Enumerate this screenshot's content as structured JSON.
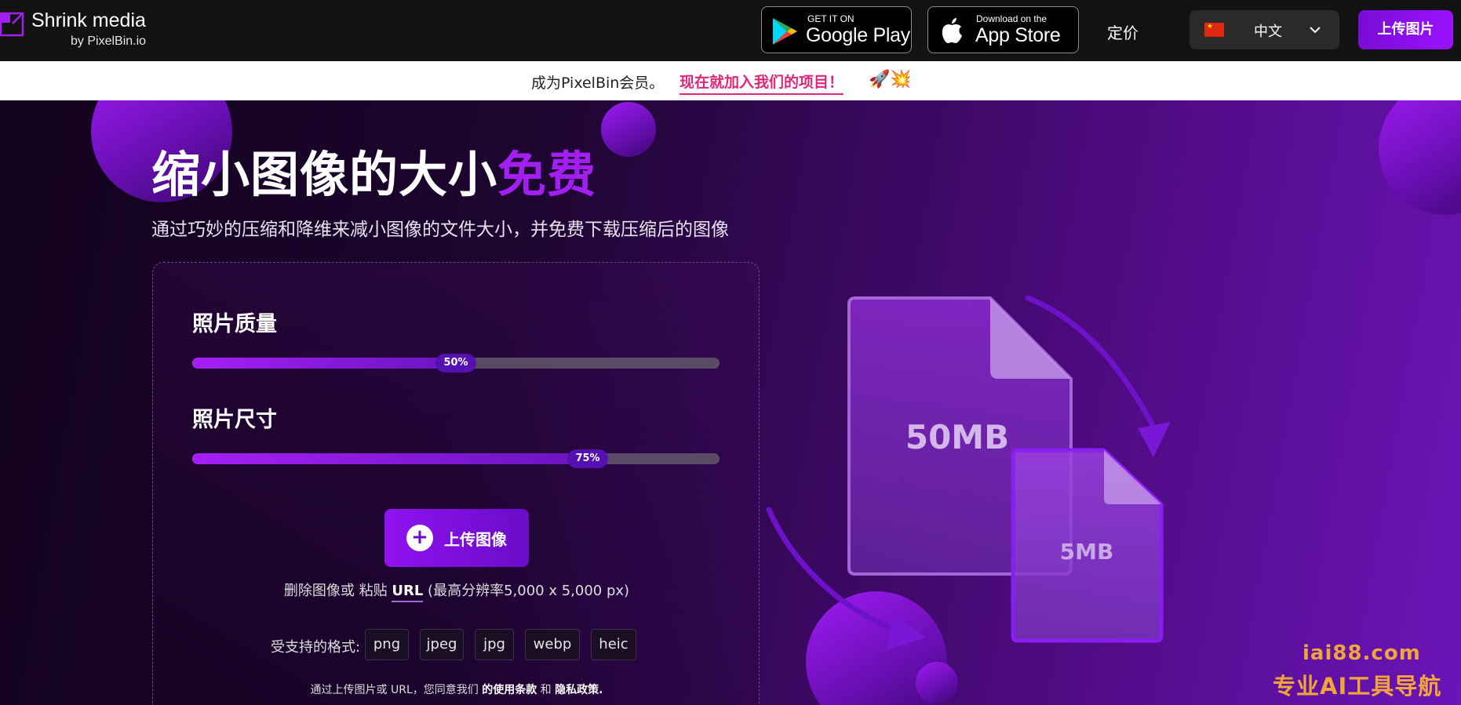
{
  "nav": {
    "logo_title": "Shrink media",
    "logo_sub": "by PixelBin.io",
    "google_play": {
      "small": "GET IT ON",
      "big": "Google Play"
    },
    "app_store": {
      "small": "Download on the",
      "big": "App Store"
    },
    "pricing": "定价",
    "language": "中文",
    "upload_button": "上传图片"
  },
  "banner": {
    "text": "成为PixelBin会员。",
    "link": "现在就加入我们的项目！",
    "emoji": "🚀💥"
  },
  "hero": {
    "title_main": "缩小图像的大小",
    "title_accent": "免费",
    "subtitle": "通过巧妙的压缩和降维来减小图像的文件大小，并免费下载压缩后的图像"
  },
  "panel": {
    "quality": {
      "label": "照片质量",
      "value_text": "50%",
      "value": 50
    },
    "size": {
      "label": "照片尺寸",
      "value_text": "75%",
      "value": 75
    },
    "upload_button": "上传图像",
    "hint_prefix": "删除图像或 粘贴 ",
    "hint_url": "URL",
    "hint_suffix": " (最高分辨率5,000 x 5,000 px)",
    "formats_label": "受支持的格式:",
    "formats": [
      "png",
      "jpeg",
      "jpg",
      "webp",
      "heic"
    ],
    "terms_prefix": "通过上传图片或 URL，您同意我们 ",
    "terms_link": "的使用条款",
    "terms_mid": " 和 ",
    "privacy_link": "隐私政策."
  },
  "illustration": {
    "big_file": "50MB",
    "small_file": "5MB"
  },
  "watermark": {
    "line1": "iai88.com",
    "line2": "专业AI工具导航"
  },
  "colors": {
    "accent": "#a31ff0",
    "banner_link": "#e0267a",
    "nav_bg": "#121212"
  }
}
